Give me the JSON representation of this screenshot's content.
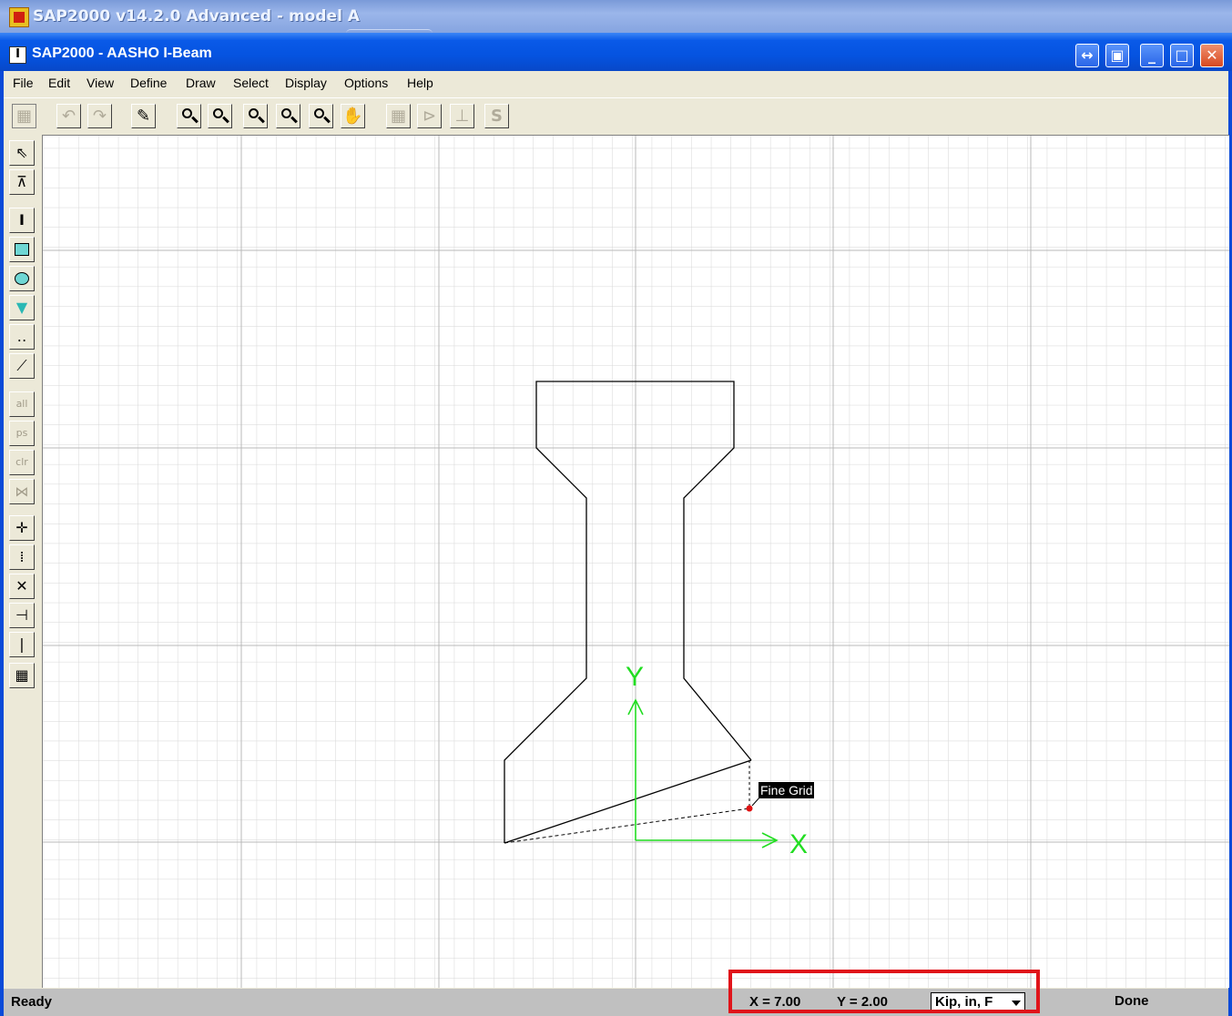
{
  "outer_window": {
    "title": "SAP2000 v14.2.0 Advanced  - model A"
  },
  "window": {
    "title": "SAP2000 - AASHO I-Beam",
    "icon_letter": "I",
    "controls": [
      "restore-arrows-icon",
      "restore-icon",
      "minimize-icon",
      "maximize-icon",
      "close-icon"
    ]
  },
  "menu": [
    "File",
    "Edit",
    "View",
    "Define",
    "Draw",
    "Select",
    "Display",
    "Options",
    "Help"
  ],
  "toolbar": {
    "icons": [
      "new-icon",
      "undo-icon",
      "redo-icon",
      "pencil-icon",
      "zoom-window-icon",
      "zoom-restore-icon",
      "zoom-in-icon",
      "zoom-in-step-icon",
      "zoom-out-icon",
      "pan-icon",
      "grid-icon",
      "axes-icon",
      "snap-icon",
      "section-s-icon"
    ]
  },
  "left_toolbar": {
    "icons": [
      "pointer-icon",
      "select-point-icon",
      "draw-i-shape-icon",
      "draw-rectangle-icon",
      "draw-circle-icon",
      "draw-polygon-icon",
      "draw-rebar-line-icon",
      "draw-line-icon",
      "select-all-icon",
      "select-previous-icon",
      "clear-selection-icon",
      "select-intersecting-icon",
      "snap-points-icon",
      "snap-midpoint-icon",
      "snap-intersection-icon",
      "snap-perpendicular-icon",
      "snap-line-icon",
      "snap-fine-grid-icon"
    ],
    "disabled_labels": [
      "all",
      "ps",
      "clr"
    ]
  },
  "canvas": {
    "axis_x_label": "X",
    "axis_y_label": "Y",
    "tooltip": "Fine Grid"
  },
  "status": {
    "left": "Ready",
    "x_label": "X = 7.00",
    "y_label": "Y = 2.00",
    "units": "Kip, in, F",
    "right": "Done"
  },
  "colors": {
    "titlebar": "#0553e0",
    "axes": "#22dd22",
    "grid_fine": "#d6d6d6",
    "grid_major": "#b8b8b8",
    "highlight": "#e0141a",
    "snap_point": "#e01010"
  }
}
